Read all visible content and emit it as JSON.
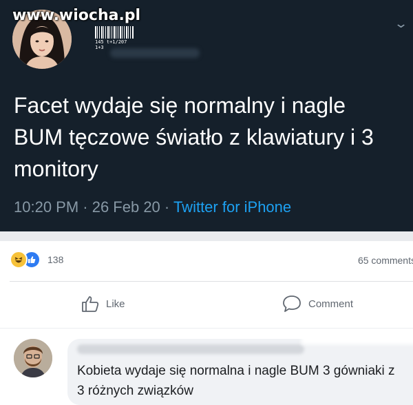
{
  "watermark": "www.wiocha.pl",
  "tweet": {
    "barcode_text": "145 t+1/207 1+3",
    "text": "Facet wydaje się normalny i nagle BUM tęczowe światło z klawiatury i 3 monitory",
    "time": "10:20 PM · 26 Feb 20 · ",
    "source": "Twitter for iPhone"
  },
  "post": {
    "reaction_icons": [
      "haha-icon",
      "like-icon"
    ],
    "reaction_count": "138",
    "comments_count": "65 comments",
    "like_label": "Like",
    "comment_label": "Comment"
  },
  "comment": {
    "text": "Kobieta wydaje się normalna i nagle BUM 3 gówniaki z 3 różnych związków"
  },
  "colors": {
    "tweet_bg": "#15202b",
    "tweet_meta": "#8899a6",
    "twitter_blue": "#1da1f2",
    "fb_like_blue": "#2e7bf2",
    "haha_yellow": "#f7c23a"
  }
}
